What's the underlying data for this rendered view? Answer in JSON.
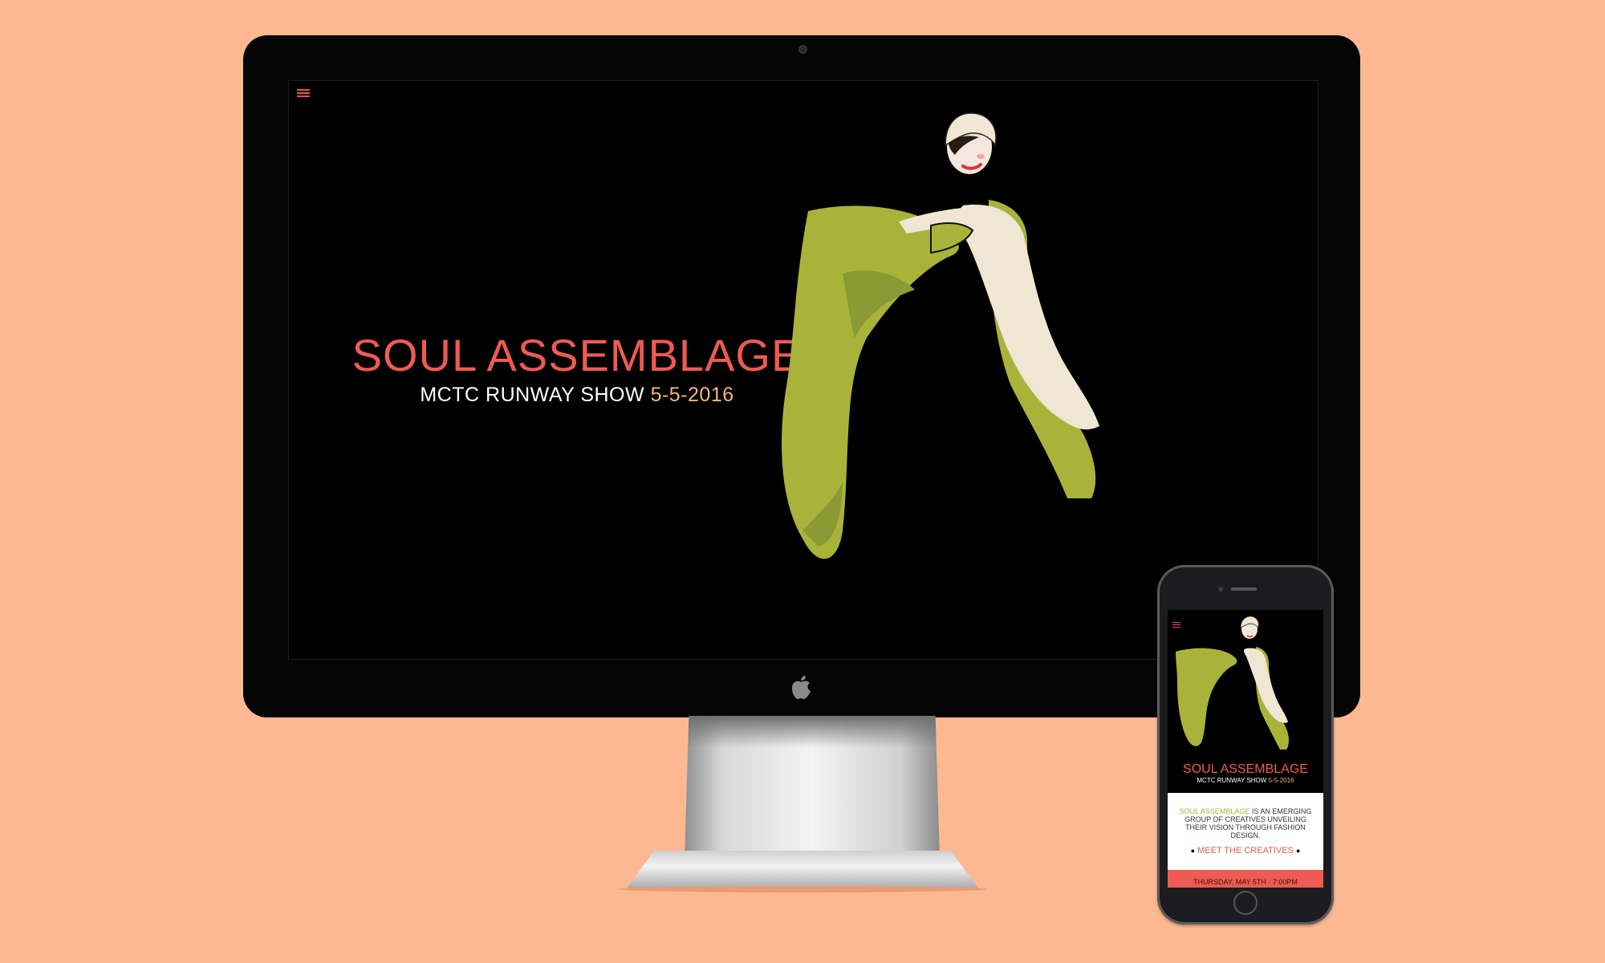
{
  "desktop": {
    "hero": {
      "title": "SOUL ASSEMBLAGE",
      "subtitle": "MCTC RUNWAY SHOW",
      "date": "5-5-2016"
    },
    "menu_icon": "hamburger-menu-icon",
    "illustration": "fashion-woman-green-cape-illustration"
  },
  "mobile": {
    "hero": {
      "title": "SOUL ASSEMBLAGE",
      "subtitle": "MCTC RUNWAY SHOW",
      "date": "5-5-2016"
    },
    "intro": {
      "brand": "SOUL ASSEMBLAGE",
      "text": "IS AN EMERGING GROUP OF CREATIVES UNVEILING THEIR VISION THROUGH FASHION DESIGN."
    },
    "cta": {
      "bullet_left": "●",
      "label": "MEET THE CREATIVES",
      "bullet_right": "●"
    },
    "event_band": "THURSDAY, MAY 5TH  ·  7:00PM"
  },
  "colors": {
    "background": "#fdb892",
    "accent_red": "#ef5a52",
    "accent_green": "#a8b23a",
    "date_gold": "#f2b87a"
  }
}
